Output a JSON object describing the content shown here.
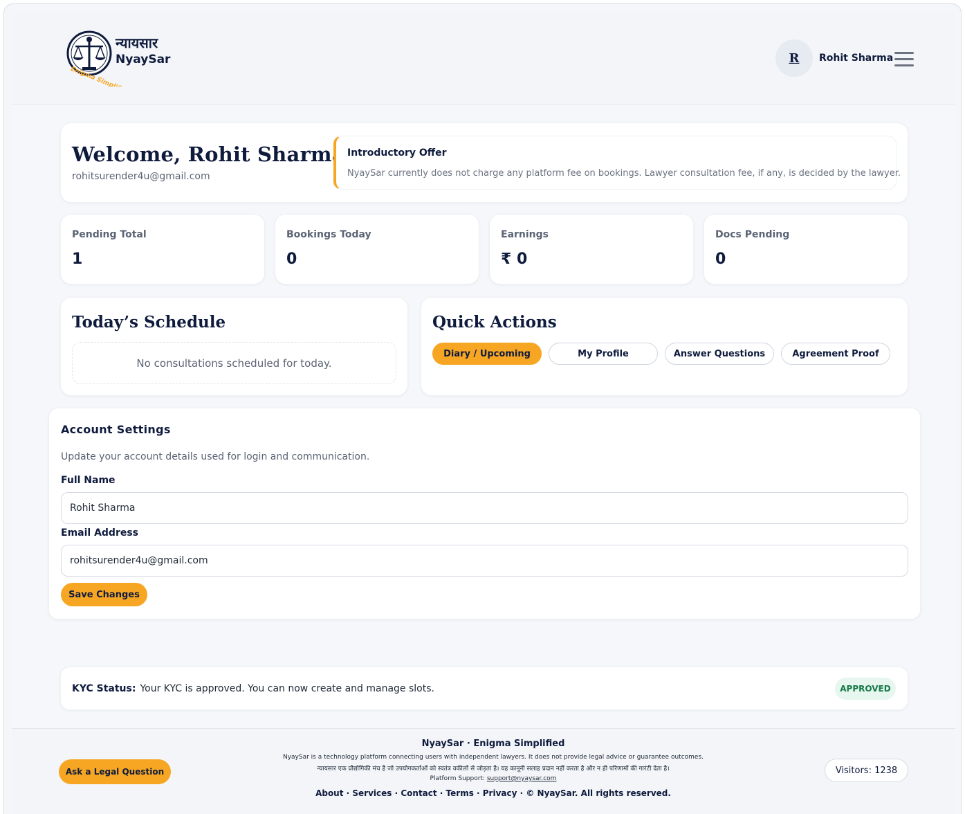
{
  "header": {
    "logo": {
      "hindi_text": "न्यायसार",
      "name": "NyaySar",
      "tagline": "Enigma Simplified"
    },
    "user": {
      "avatar_initial": "R",
      "name": "Rohit Sharma"
    }
  },
  "welcome": {
    "title": "Welcome, Rohit Sharma",
    "email": "rohitsurender4u@gmail.com",
    "offer_title": "Introductory Offer",
    "offer_text": "NyaySar currently does not charge any platform fee on bookings. Lawyer consultation fee, if any, is decided by the lawyer."
  },
  "stats": [
    {
      "label": "Pending Total",
      "value": "1"
    },
    {
      "label": "Bookings Today",
      "value": "0"
    },
    {
      "label": "Earnings",
      "value": "₹ 0"
    },
    {
      "label": "Docs Pending",
      "value": "0"
    }
  ],
  "schedule": {
    "title": "Today’s Schedule",
    "empty_text": "No consultations scheduled for today."
  },
  "quick_actions": {
    "title": "Quick Actions",
    "buttons": [
      "Diary / Upcoming",
      "My Profile",
      "Answer Questions",
      "Agreement Proof"
    ]
  },
  "settings": {
    "title": "Account Settings",
    "subtitle": "Update your account details used for login and communication.",
    "full_name_label": "Full Name",
    "full_name_value": "Rohit Sharma",
    "email_label": "Email Address",
    "email_value": "rohitsurender4u@gmail.com",
    "save_label": "Save Changes"
  },
  "kyc": {
    "label": "KYC Status:",
    "text": "Your KYC is approved. You can now create and manage slots.",
    "badge": "APPROVED"
  },
  "footer": {
    "ask_label": "Ask a Legal Question",
    "title": "NyaySar · Enigma Simplified",
    "disclaimer_en": "NyaySar is a technology platform connecting users with independent lawyers. It does not provide legal advice or guarantee outcomes.",
    "disclaimer_hi": "न्यायसार एक प्रौद्योगिकी मंच है जो उपयोगकर्ताओं को स्वतंत्र वकीलों से जोड़ता है। यह कानूनी सलाह प्रदान नहीं करता है और न ही परिणामों की गारंटी देता है।",
    "support_label": "Platform Support:",
    "support_email": "support@nyaysar.com",
    "links": [
      "About",
      "Services",
      "Contact",
      "Terms",
      "Privacy"
    ],
    "copyright": "© NyaySar. All rights reserved.",
    "visitors": "Visitors: 1238"
  },
  "colors": {
    "accent": "#f6a623",
    "navy": "#0f1b3d",
    "approved_bg": "#e7f6ee",
    "approved_text": "#16794a"
  }
}
